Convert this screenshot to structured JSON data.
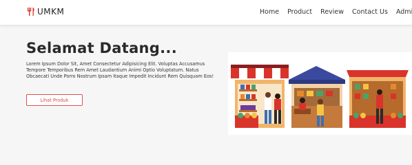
{
  "brand": {
    "name": "UMKM",
    "accent": "#d9342b"
  },
  "nav": {
    "links": [
      "Home",
      "Product",
      "Review",
      "Contact Us",
      "Admin"
    ]
  },
  "hero": {
    "title": "Selamat Datang...",
    "description": "Lorem Ipsum Dolor Sit, Amet Consectetur Adipisicing Elit. Voluptas Accusamus Tempore Temporibus Rem Amet Laudantium Animi Optio Voluptatum. Natus Obcaecati Unde Porro Nostrum Ipsam Itaque Impedit Incidunt Rem Quisquam Eos!",
    "button_label": "Lihat Produk",
    "illustration": "market-stalls-illustration"
  },
  "colors": {
    "accent": "#e05050",
    "hero_bg": "#f6f6f6"
  }
}
